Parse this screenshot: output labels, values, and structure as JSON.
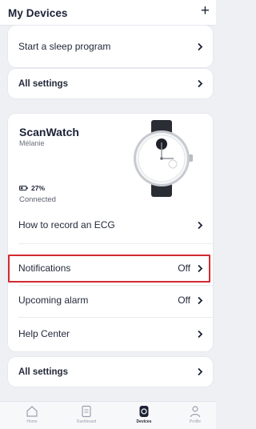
{
  "header": {
    "title": "My Devices",
    "add_label": "+"
  },
  "top_card": {
    "rows": [
      {
        "label": "Start a sleep program"
      }
    ]
  },
  "settings_card_1": {
    "label": "All settings"
  },
  "device": {
    "name": "ScanWatch",
    "owner": "Mélanie",
    "battery": "27%",
    "status": "Connected",
    "rows": [
      {
        "label": "How to record an ECG",
        "value": ""
      },
      {
        "label": "Notifications",
        "value": "Off"
      },
      {
        "label": "Upcoming alarm",
        "value": "Off"
      },
      {
        "label": "Help Center",
        "value": ""
      }
    ]
  },
  "settings_card_2": {
    "label": "All settings"
  },
  "tabbar": {
    "tabs": [
      {
        "label": "Home",
        "icon": "home-icon",
        "active": false
      },
      {
        "label": "Dashboard",
        "icon": "dashboard-icon",
        "active": false
      },
      {
        "label": "Devices",
        "icon": "watch-icon",
        "active": true
      },
      {
        "label": "Profile",
        "icon": "profile-icon",
        "active": false
      }
    ]
  },
  "colors": {
    "highlight": "#d22a32",
    "background": "#eef0f4",
    "text": "#1b2236"
  }
}
